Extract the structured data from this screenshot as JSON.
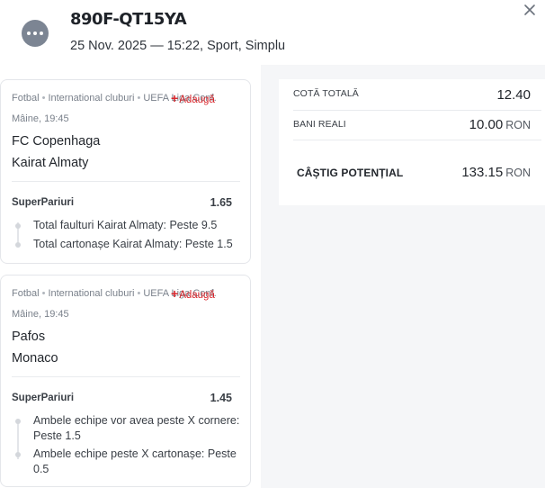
{
  "header": {
    "ticket_id": "890F-QT15YA",
    "subtitle": "25 Nov. 2025 — 15:22, Sport, Simplu",
    "avatar_icon": "more-dots-icon",
    "close_icon": "close-icon"
  },
  "colors": {
    "accent_red": "#d9262c",
    "background": "#f5f6f8",
    "card_border": "#e4e6ea"
  },
  "bets": [
    {
      "sport": "Fotbal",
      "category": "International cluburi",
      "league": "UEFA Liga Conf.",
      "add_label": "Adaugă",
      "time": "Mâine, 19:45",
      "home": "FC Copenhaga",
      "away": "Kairat Almaty",
      "provider": "SuperPariuri",
      "odds": "1.65",
      "selections": [
        "Total faulturi Kairat Almaty: Peste 9.5",
        "Total cartonașe Kairat Almaty: Peste 1.5"
      ]
    },
    {
      "sport": "Fotbal",
      "category": "International cluburi",
      "league": "UEFA Liga Conf.",
      "add_label": "Adaugă",
      "time": "Mâine, 19:45",
      "home": "Pafos",
      "away": "Monaco",
      "provider": "SuperPariuri",
      "odds": "1.45",
      "selections": [
        "Ambele echipe vor avea peste X cornere: Peste 1.5",
        "Ambele echipe peste X cartonașe: Peste 0.5"
      ]
    }
  ],
  "summary": {
    "total_odds_label": "COTĂ TOTALĂ",
    "total_odds_value": "12.40",
    "stake_label": "BANI REALI",
    "stake_value": "10.00",
    "currency": "RON",
    "potential_label": "CÂȘTIG POTENȚIAL",
    "potential_value": "133.15"
  }
}
